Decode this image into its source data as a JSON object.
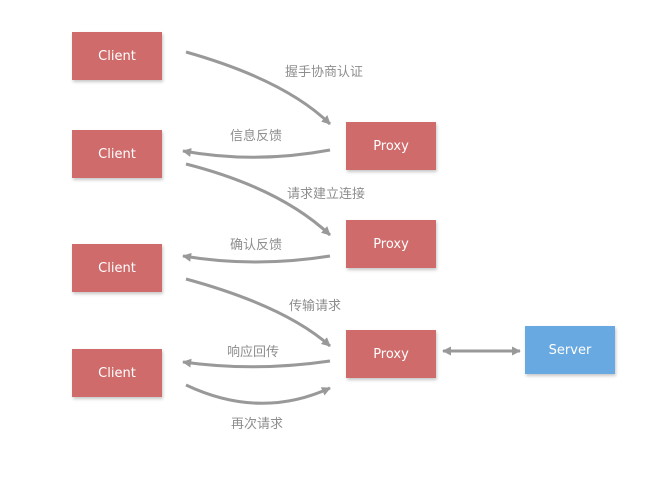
{
  "colors": {
    "client_fill": "#cf6b6b",
    "proxy_fill": "#cf6b6b",
    "server_fill": "#67a9e0",
    "arrow": "#999999",
    "label_text": "#8e8e8e"
  },
  "nodes": {
    "clients": [
      "Client",
      "Client",
      "Client",
      "Client"
    ],
    "proxies": [
      "Proxy",
      "Proxy",
      "Proxy"
    ],
    "server": "Server"
  },
  "edges": [
    {
      "from": "client-1",
      "to": "proxy-1",
      "label": "握手协商认证"
    },
    {
      "from": "proxy-1",
      "to": "client-2",
      "label": "信息反馈"
    },
    {
      "from": "client-2",
      "to": "proxy-2",
      "label": "请求建立连接"
    },
    {
      "from": "proxy-2",
      "to": "client-3",
      "label": "确认反馈"
    },
    {
      "from": "client-3",
      "to": "proxy-3",
      "label": "传输请求"
    },
    {
      "from": "proxy-3",
      "to": "client-4",
      "label": "响应回传"
    },
    {
      "from": "client-4",
      "to": "proxy-3",
      "label": "再次请求"
    },
    {
      "from": "proxy-3",
      "to": "server",
      "label": "",
      "bidirectional": true
    }
  ]
}
